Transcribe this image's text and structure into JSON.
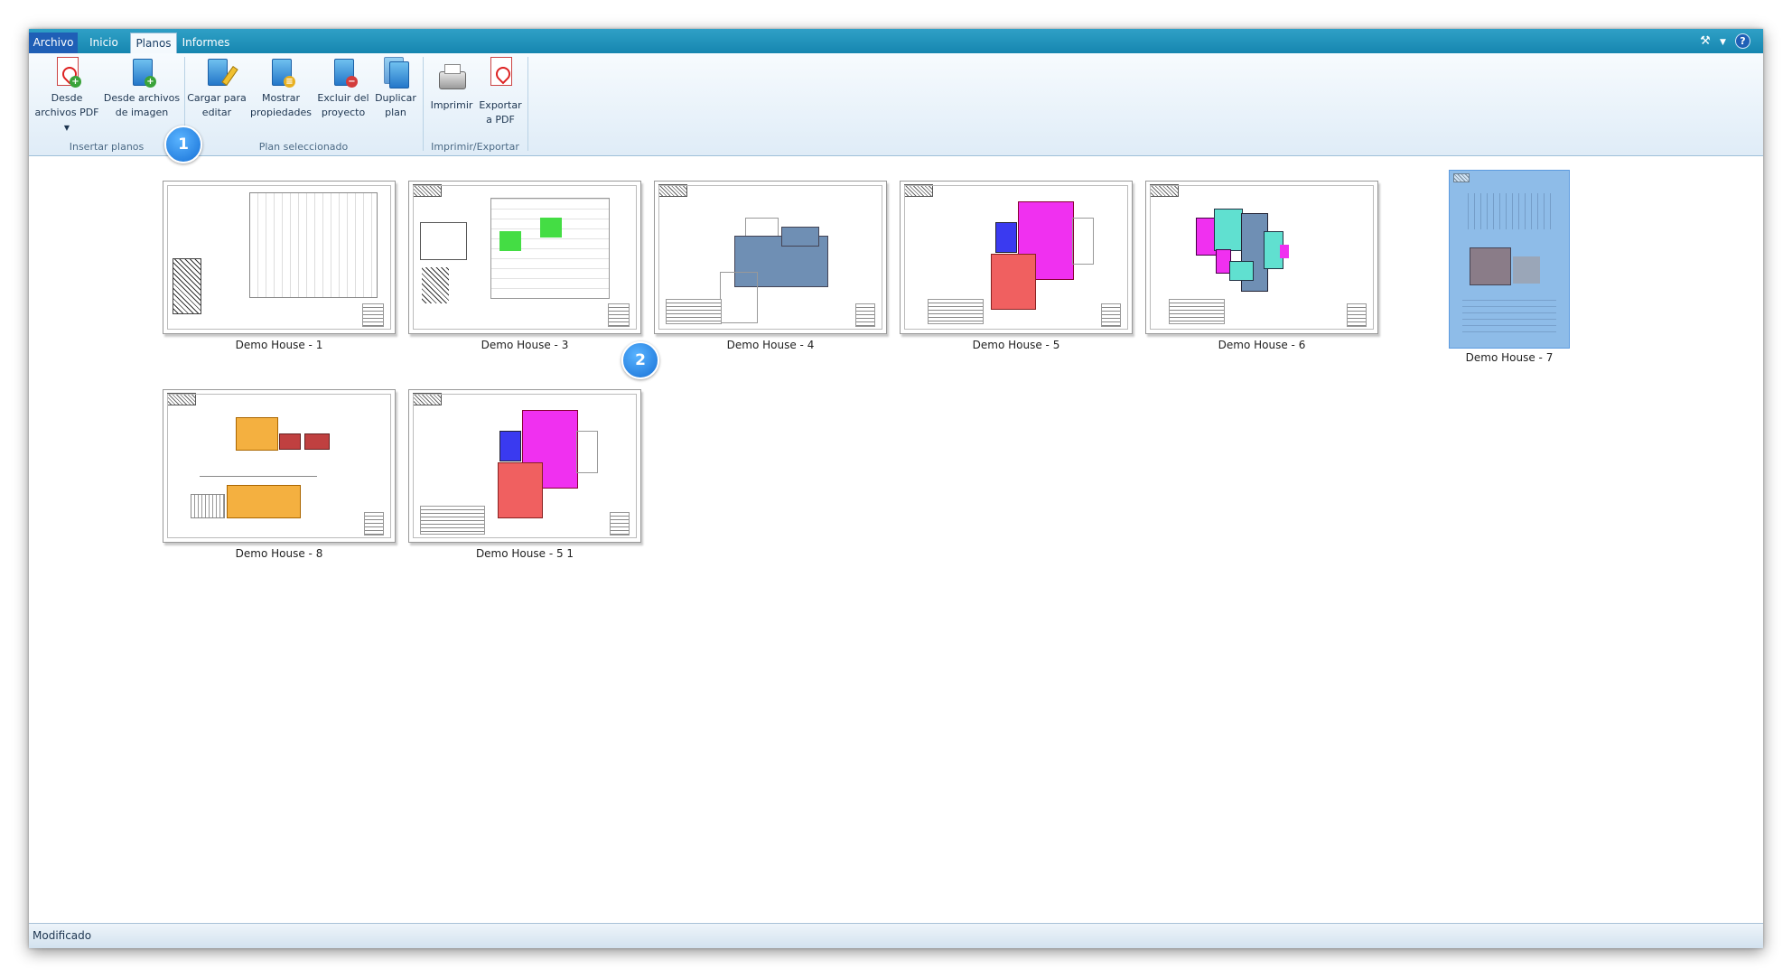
{
  "tabs": [
    {
      "label": "Archivo"
    },
    {
      "label": "Inicio"
    },
    {
      "label": "Planos"
    },
    {
      "label": "Informes"
    }
  ],
  "ribbon": {
    "insert_group": {
      "label": "Insertar planos",
      "from_pdf_line1": "Desde",
      "from_pdf_line2": "archivos PDF",
      "from_image_line1": "Desde archivos",
      "from_image_line2": "de imagen"
    },
    "selected_group": {
      "label": "Plan seleccionado",
      "load_line1": "Cargar para",
      "load_line2": "editar",
      "props_line1": "Mostrar",
      "props_line2": "propiedades",
      "exclude_line1": "Excluir del",
      "exclude_line2": "proyecto",
      "dup_line1": "Duplicar",
      "dup_line2": "plan"
    },
    "print_group": {
      "label": "Imprimir/Exportar",
      "print": "Imprimir",
      "export_line1": "Exportar",
      "export_line2": "a PDF"
    }
  },
  "steps": {
    "one": "1",
    "two": "2"
  },
  "plans": [
    {
      "name": "Demo House - 1"
    },
    {
      "name": "Demo House - 3"
    },
    {
      "name": "Demo House - 4"
    },
    {
      "name": "Demo House - 5"
    },
    {
      "name": "Demo House - 6"
    },
    {
      "name": "Demo House - 7"
    },
    {
      "name": "Demo House - 8"
    },
    {
      "name": "Demo House - 5 1"
    }
  ],
  "status": {
    "text": "Modificado"
  },
  "colors": {
    "tabbar": "#1686b0",
    "selected": "#8ebce8",
    "step_badge": "#1670d6"
  }
}
